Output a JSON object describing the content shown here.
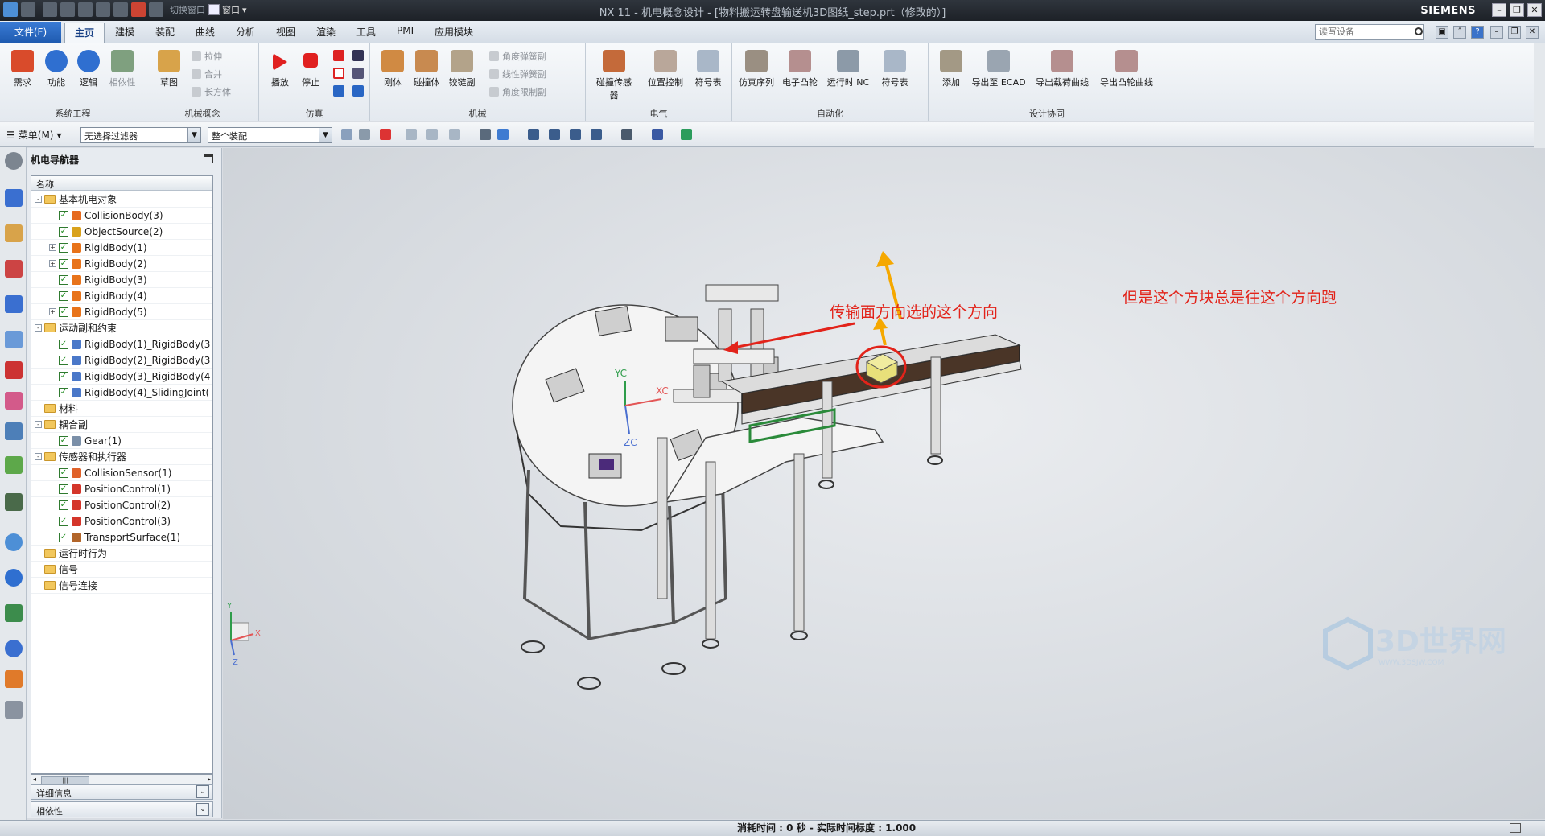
{
  "titlebar": {
    "quick_label": "切换窗口",
    "window_label": "窗口",
    "title": "NX 11 - 机电概念设计 - [物料搬运转盘输送机3D图纸_step.prt（修改的）]",
    "brand": "SIEMENS"
  },
  "menu": {
    "file": "文件(F)",
    "tabs": [
      "主页",
      "建模",
      "装配",
      "曲线",
      "分析",
      "视图",
      "渲染",
      "工具",
      "PMI",
      "应用模块"
    ],
    "search_placeholder": "读写设备"
  },
  "ribbon": {
    "groups": [
      {
        "label": "系统工程",
        "buttons": [
          "需求",
          "功能",
          "逻辑",
          "相依性"
        ]
      },
      {
        "label": "机械概念",
        "buttons": [
          "草图"
        ],
        "small": [
          "拉伸",
          "合并",
          "长方体"
        ]
      },
      {
        "label": "仿真",
        "buttons": [
          "播放",
          "停止"
        ]
      },
      {
        "label": "机械",
        "buttons": [
          "刚体",
          "碰撞体",
          "铰链副"
        ],
        "small": [
          "角度弹簧副",
          "线性弹簧副",
          "角度限制副"
        ]
      },
      {
        "label": "电气",
        "buttons": [
          "碰撞传感器",
          "位置控制",
          "符号表"
        ]
      },
      {
        "label": "自动化",
        "buttons": [
          "仿真序列",
          "电子凸轮",
          "运行时 NC",
          "符号表"
        ]
      },
      {
        "label": "设计协同",
        "buttons": [
          "添加",
          "导出至 ECAD",
          "导出载荷曲线",
          "导出凸轮曲线"
        ]
      }
    ]
  },
  "toolbar2": {
    "menu_label": "菜单(M)",
    "filter": "无选择过滤器",
    "scope": "整个装配"
  },
  "navigator": {
    "title": "机电导航器",
    "column_header": "名称",
    "rows": [
      {
        "label": "基本机电对象",
        "kind": "folder",
        "level": 0,
        "exp": "-"
      },
      {
        "label": "CollisionBody(3)",
        "kind": "item",
        "level": 1,
        "exp": "",
        "icon": "#e66a1f"
      },
      {
        "label": "ObjectSource(2)",
        "kind": "item",
        "level": 1,
        "exp": "",
        "icon": "#d9a21c"
      },
      {
        "label": "RigidBody(1)",
        "kind": "item",
        "level": 1,
        "exp": "+",
        "icon": "#e8731a"
      },
      {
        "label": "RigidBody(2)",
        "kind": "item",
        "level": 1,
        "exp": "+",
        "icon": "#e8731a"
      },
      {
        "label": "RigidBody(3)",
        "kind": "item",
        "level": 1,
        "exp": "",
        "icon": "#e8731a"
      },
      {
        "label": "RigidBody(4)",
        "kind": "item",
        "level": 1,
        "exp": "",
        "icon": "#e8731a"
      },
      {
        "label": "RigidBody(5)",
        "kind": "item",
        "level": 1,
        "exp": "+",
        "icon": "#e8731a"
      },
      {
        "label": "运动副和约束",
        "kind": "folder",
        "level": 0,
        "exp": "-"
      },
      {
        "label": "RigidBody(1)_RigidBody(3",
        "kind": "item",
        "level": 1,
        "exp": "",
        "icon": "#4a78c9"
      },
      {
        "label": "RigidBody(2)_RigidBody(3",
        "kind": "item",
        "level": 1,
        "exp": "",
        "icon": "#4a78c9"
      },
      {
        "label": "RigidBody(3)_RigidBody(4",
        "kind": "item",
        "level": 1,
        "exp": "",
        "icon": "#4a78c9"
      },
      {
        "label": "RigidBody(4)_SlidingJoint(",
        "kind": "item",
        "level": 1,
        "exp": "",
        "icon": "#4a78c9"
      },
      {
        "label": "材料",
        "kind": "folder",
        "level": 0,
        "exp": ""
      },
      {
        "label": "耦合副",
        "kind": "folder",
        "level": 0,
        "exp": "-"
      },
      {
        "label": "Gear(1)",
        "kind": "item",
        "level": 1,
        "exp": "",
        "icon": "#7a8fa8"
      },
      {
        "label": "传感器和执行器",
        "kind": "folder",
        "level": 0,
        "exp": "-"
      },
      {
        "label": "CollisionSensor(1)",
        "kind": "item",
        "level": 1,
        "exp": "",
        "icon": "#e0622a"
      },
      {
        "label": "PositionControl(1)",
        "kind": "item",
        "level": 1,
        "exp": "",
        "icon": "#d4352a"
      },
      {
        "label": "PositionControl(2)",
        "kind": "item",
        "level": 1,
        "exp": "",
        "icon": "#d4352a"
      },
      {
        "label": "PositionControl(3)",
        "kind": "item",
        "level": 1,
        "exp": "",
        "icon": "#d4352a"
      },
      {
        "label": "TransportSurface(1)",
        "kind": "item",
        "level": 1,
        "exp": "",
        "icon": "#b2652a"
      },
      {
        "label": "运行时行为",
        "kind": "folder",
        "level": 0,
        "exp": ""
      },
      {
        "label": "信号",
        "kind": "folder",
        "level": 0,
        "exp": ""
      },
      {
        "label": "信号连接",
        "kind": "folder",
        "level": 0,
        "exp": ""
      }
    ],
    "details": "详细信息",
    "dependency": "相依性"
  },
  "viewport": {
    "annotation_left": "传输面方向选的这个方向",
    "annotation_right": "但是这个方块总是往这个方向跑",
    "axis_xc": "XC",
    "axis_yc": "YC",
    "axis_zc": "ZC",
    "triad_x": "X",
    "triad_y": "Y",
    "triad_z": "Z",
    "watermark_main": "3D世界网",
    "watermark_sub": "WWW.3DSJW.COM",
    "colors": {
      "annotation_red": "#e2231a",
      "arrow_orange": "#f5a800",
      "block_yellow": "#e8e07a",
      "belt": "#4a3527"
    }
  },
  "status": {
    "text": "消耗时间 : 0 秒 - 实际时间标度 : 1.000"
  }
}
